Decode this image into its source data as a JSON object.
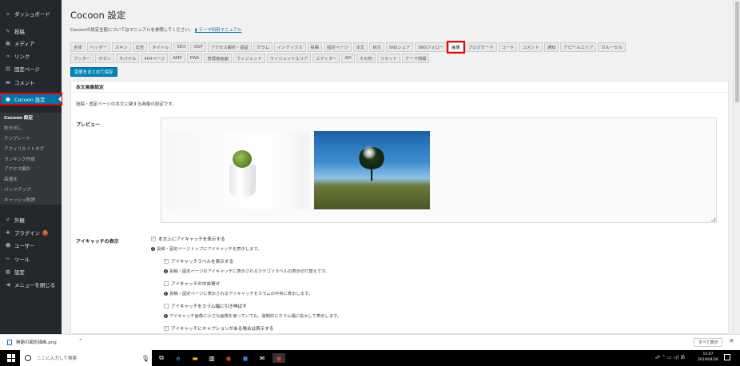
{
  "sidebar": {
    "items": [
      {
        "icon": "dashboard-icon",
        "glyph": "⌂",
        "label": "ダッシュボード"
      },
      {
        "icon": "pin-icon",
        "glyph": "✎",
        "label": "投稿"
      },
      {
        "icon": "media-icon",
        "glyph": "▣",
        "label": "メディア"
      },
      {
        "icon": "link-icon",
        "glyph": "∞",
        "label": "リンク"
      },
      {
        "icon": "page-icon",
        "glyph": "▤",
        "label": "固定ページ"
      },
      {
        "icon": "comment-icon",
        "glyph": "▬",
        "label": "コメント"
      },
      {
        "icon": "cocoon-icon",
        "glyph": "●",
        "label": "Cocoon 設定"
      }
    ],
    "submenu": [
      "Cocoon 設定",
      "吹き出し",
      "テンプレート",
      "アフィリエイトタグ",
      "ランキング作成",
      "アクセス集計",
      "高速化",
      "バックアップ",
      "キャッシュ削除"
    ],
    "lower_items": [
      {
        "icon": "appearance-icon",
        "glyph": "✐",
        "label": "外観"
      },
      {
        "icon": "plugin-icon",
        "glyph": "✚",
        "label": "プラグイン",
        "badge": "1"
      },
      {
        "icon": "user-icon",
        "glyph": "☻",
        "label": "ユーザー"
      },
      {
        "icon": "tool-icon",
        "glyph": "✂",
        "label": "ツール"
      },
      {
        "icon": "settings-icon",
        "glyph": "▦",
        "label": "設定"
      },
      {
        "icon": "collapse-icon",
        "glyph": "◀",
        "label": "メニューを閉じる"
      }
    ]
  },
  "header": {
    "title": "Cocoon 設定",
    "description": "Cocoonの設定全般についてはマニュアルを参照してください。",
    "manual_link": "テーマ利用マニュアル"
  },
  "tabs": {
    "row1": [
      "全体",
      "ヘッダー",
      "スキン",
      "広告",
      "タイトル",
      "SEO",
      "OGP",
      "アクセス解析・認証",
      "カラム",
      "インデックス",
      "投稿",
      "固定ページ",
      "本文",
      "目次",
      "SNSシェア",
      "SNSフォロー",
      "画像",
      "ブログカード",
      "コード",
      "コメント",
      "通知",
      "アピールエリア",
      "カルーセル"
    ],
    "row2": [
      "フッター",
      "ボタン",
      "モバイル",
      "404ページ",
      "AMP",
      "PWA",
      "管理者画面",
      "ウィジェット",
      "ウィジェットエリア",
      "エディター",
      "API",
      "その他",
      "リセット",
      "テーマ情報"
    ],
    "active": "画像"
  },
  "save_button": "変更をまとめて保存",
  "panel": {
    "heading": "本文画像設定",
    "description": "投稿・固定ページの本文に関する画像の設定です。",
    "preview_label": "プレビュー",
    "eyecatch_label": "アイキャッチの表示",
    "options": [
      {
        "label": "本文上にアイキャッチを表示する",
        "checked": true,
        "note": "投稿・固定ページトップにアイキャッチを表示します。"
      },
      {
        "label": "アイキャッチラベルを表示する",
        "checked": true,
        "note": "投稿・固定ページのアイキャッチに表示されるカテゴリラベルの表示切り替えです。"
      },
      {
        "label": "アイキャッチの中央寄せ",
        "checked": false,
        "note": "投稿・固定ページに表示されるアイキャッチをカラムの中央に表示します。"
      },
      {
        "label": "アイキャッチをカラム幅に引き伸ばす",
        "checked": false,
        "note": "アイキャッチ画像に小さな画像を使っていても、強制的にカラム幅に拡大して表示します。"
      },
      {
        "label": "アイキャッチにキャプションがある場合は表示する",
        "checked": true,
        "note": ""
      }
    ]
  },
  "download_bar": {
    "file_name": "無題の図形描画.png",
    "show_all": "すべて表示",
    "close": "✕"
  },
  "taskbar": {
    "search_placeholder": "ここに入力して検索",
    "time": "15:07",
    "date": "2019/04/26"
  },
  "colors": {
    "sidebar_bg": "#23282d",
    "accent": "#0073aa",
    "highlight_outline": "#ee0000",
    "button": "#0085ba"
  }
}
